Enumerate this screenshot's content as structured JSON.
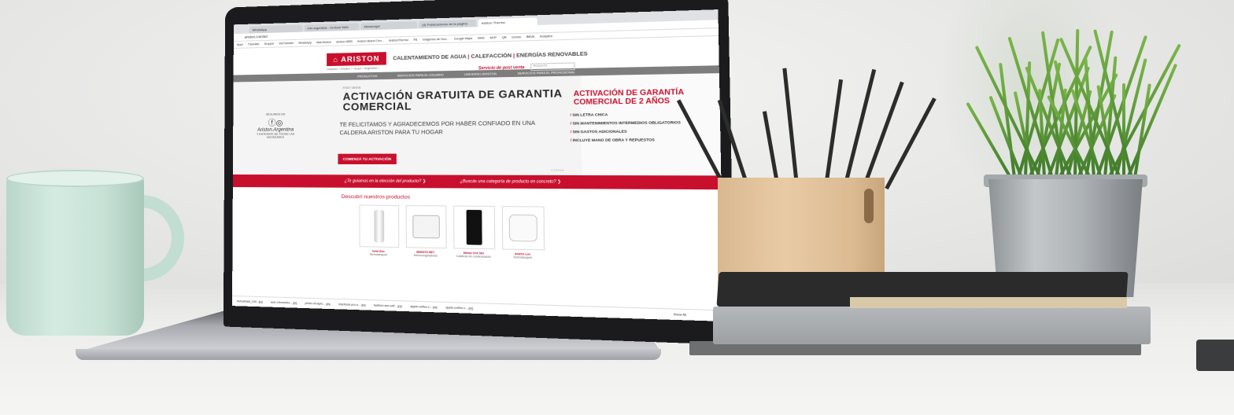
{
  "browser": {
    "tabs": [
      "WhatsApp",
      "info argentina - Outlook Web",
      "Messenger",
      "(4) Publicaciones de la página",
      "Ariston Thermo"
    ],
    "active_tab_index": 4,
    "address": "ariston.com/ar/",
    "bookmarks": [
      "Apps",
      "Translate",
      "Dropper",
      "WeTransfer",
      "WhatsApp",
      "Mail Ariston",
      "ariston WEB",
      "Ariston Brand Cen...",
      "AristonThermo",
      "FB",
      "Imágenes de Goo...",
      "Google Maps",
      "SMG",
      "AFIP",
      "QR",
      "Iconos",
      "BBVA",
      "Analytics"
    ]
  },
  "site": {
    "logo": "ARISTON",
    "tagline_a": "CALENTAMIENTO DE AGUA",
    "tagline_b": "CALEFACCIÓN",
    "tagline_c": "ENERGÍAS RENOVABLES",
    "breadcrumb": "contacto > Empleo > Grupo > Argentina >",
    "postventa": "Servicio de post venta",
    "search_placeholder": "Búsqueda",
    "nav": [
      "PRODUCTOS",
      "SERVICIOS PARA EL USUARIO",
      "UNIVERSO ARISTON",
      "SERVICIOS PARA EL PROFESIONAL"
    ]
  },
  "hero": {
    "eyebrow": "POST VENTA",
    "title": "ACTIVACIÓN GRATUITA DE GARANTIA COMERCIAL",
    "subtitle": "TE FELICITAMOS Y AGRADECEMOS POR HABER CONFIADO EN UNA CALDERA ARISTON PARA TU HOGAR",
    "cta": "COMENZÁ TU ACTIVACIÓN",
    "follow_label": "SEGUINOS EN",
    "follow_handle": "Ariston.Argentina",
    "follow_note": "Y ENTERATE DE TODAS LAS NOVEDADES",
    "right_title": "ACTIVACIÓN DE GARANTÍA COMERCIAL DE 2 AÑOS",
    "right_items": [
      "SIN LETRA CHICA",
      "SIN MANTENIMIENTOS INTERMEDIOS OBLIGATORIOS",
      "SIN GASTOS ADICIONALES",
      "INCLUYE MANO DE OBRA Y REPUESTOS"
    ],
    "dots": "1 2 3 4 5 6"
  },
  "redbar": {
    "left": "¿Te guiamos en la elección del producto?",
    "right": "¿Buscás una categoría de producto en concreto?"
  },
  "products": {
    "title": "Descubrí nuestros productos",
    "items": [
      {
        "name": "Velis Evo",
        "category": "Termotanques"
      },
      {
        "name": "SENSYS NET",
        "category": "Termorreguladores"
      },
      {
        "name": "Alteas One Net",
        "category": "Calderas de condensación"
      },
      {
        "name": "Andris Lux",
        "category": "Termotanques"
      }
    ]
  },
  "downloads": {
    "items": [
      "Actualidad_100...jpg",
      "acer-chromebo....jpg",
      "photo-of-lapto....jpg",
      "macbook-pro-o....jpg",
      "fashion-am-coff....jpg",
      "apple-coffee-c....jpg",
      "apple-coffee-c....jpg"
    ],
    "show_all": "Show All"
  },
  "colors": {
    "brand_red": "#c8102e"
  }
}
